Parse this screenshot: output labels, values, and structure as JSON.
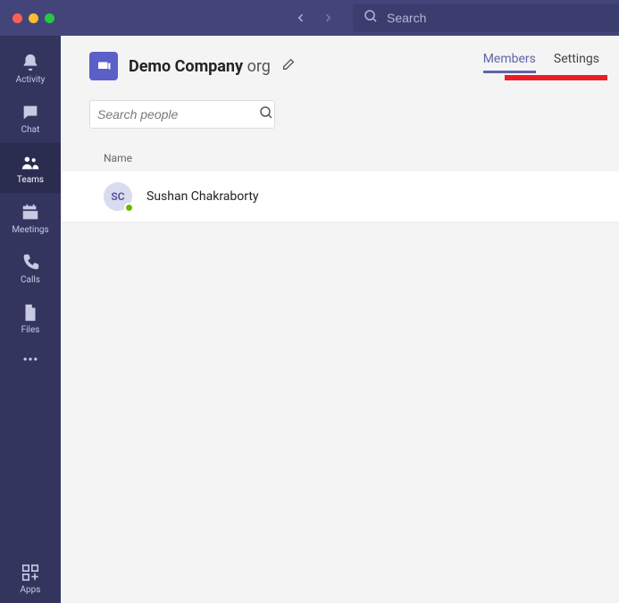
{
  "titlebar": {
    "mac_dots": [
      "#ff5f57",
      "#febc2e",
      "#28c840"
    ],
    "search_placeholder": "Search"
  },
  "rail_items": [
    {
      "id": "activity",
      "label": "Activity",
      "active": false
    },
    {
      "id": "chat",
      "label": "Chat",
      "active": false
    },
    {
      "id": "teams",
      "label": "Teams",
      "active": true
    },
    {
      "id": "meetings",
      "label": "Meetings",
      "active": false
    },
    {
      "id": "calls",
      "label": "Calls",
      "active": false
    },
    {
      "id": "files",
      "label": "Files",
      "active": false
    }
  ],
  "rail_apps_label": "Apps",
  "header": {
    "org_name_bold": "Demo Company",
    "org_name_light": "org",
    "tabs": [
      {
        "label": "Members",
        "active": true
      },
      {
        "label": "Settings",
        "active": false
      }
    ]
  },
  "search_people_placeholder": "Search people",
  "column_header": "Name",
  "members": [
    {
      "initials": "SC",
      "name": "Sushan Chakraborty",
      "presence": "available"
    }
  ]
}
